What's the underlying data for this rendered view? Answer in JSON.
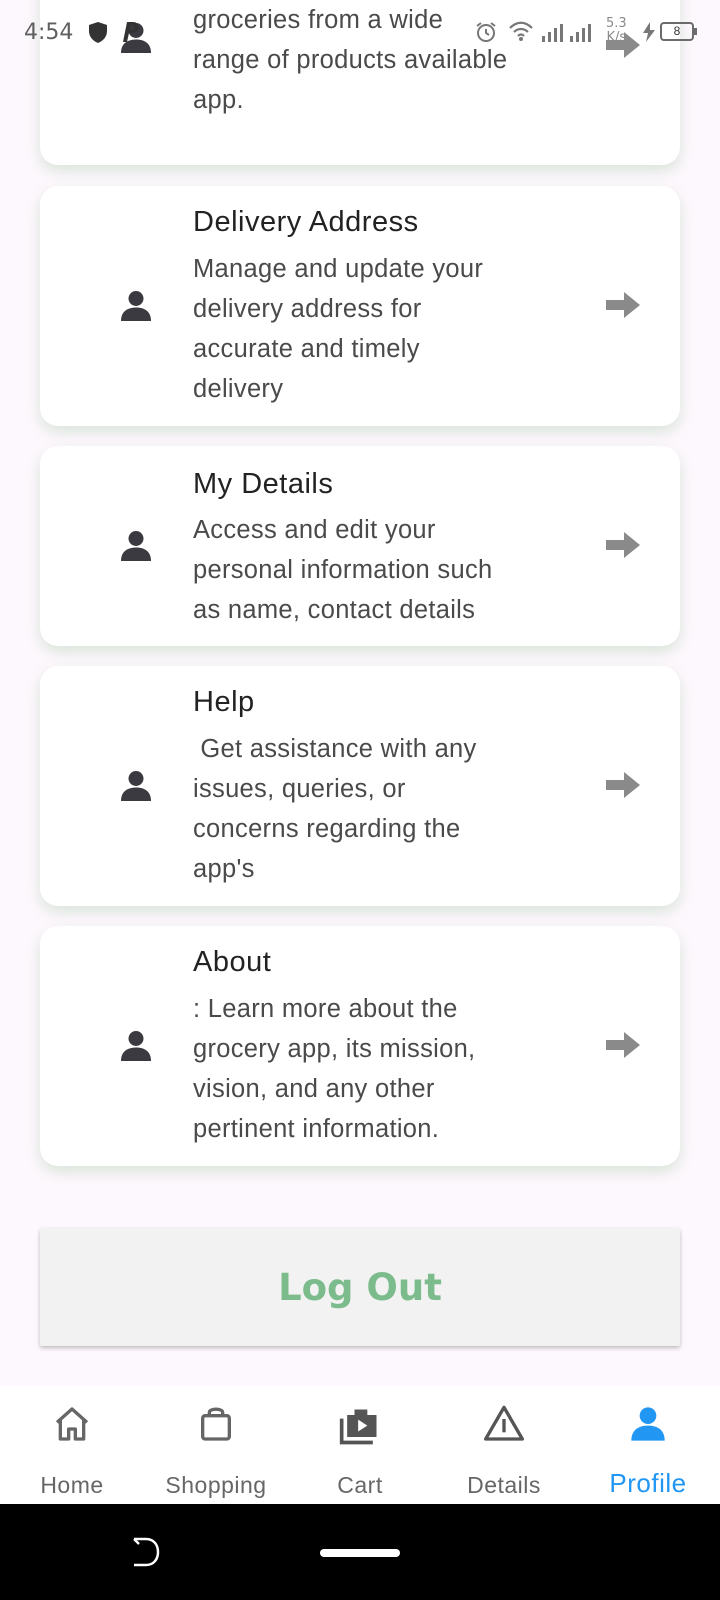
{
  "status_bar": {
    "time": "4:54",
    "net_speed_value": "5.3",
    "net_speed_unit": "K/s",
    "battery_level": "8"
  },
  "menu_items": [
    {
      "title": "",
      "description": "select, and purchase\ngroceries from a wide\nrange of products available\napp.",
      "icon": "person-icon",
      "action_icon": "arrow-right-icon"
    },
    {
      "title": "Delivery Address",
      "description": "Manage and update your\ndelivery address for\naccurate and timely\ndelivery",
      "icon": "person-icon",
      "action_icon": "arrow-right-icon"
    },
    {
      "title": "My Details",
      "description": "Access and edit your\npersonal information such\nas name, contact details",
      "icon": "person-icon",
      "action_icon": "arrow-right-icon"
    },
    {
      "title": "Help",
      "description": " Get assistance with any\nissues, queries, or\nconcerns regarding the\napp's",
      "icon": "person-icon",
      "action_icon": "arrow-right-icon"
    },
    {
      "title": "About",
      "description": ": Learn more about the\ngrocery app, its mission,\nvision, and any other\npertinent information.",
      "icon": "person-icon",
      "action_icon": "arrow-right-icon"
    }
  ],
  "logout": {
    "label": "Log Out"
  },
  "bottom_nav": {
    "items": [
      {
        "label": "Home",
        "icon": "home-icon"
      },
      {
        "label": "Shopping",
        "icon": "shopping-bag-icon"
      },
      {
        "label": "Cart",
        "icon": "cart-icon"
      },
      {
        "label": "Details",
        "icon": "warning-triangle-icon"
      },
      {
        "label": "Profile",
        "icon": "person-icon"
      }
    ],
    "active": "Profile"
  },
  "colors": {
    "accent": "#2196f3",
    "logout_text": "#7cbc8c",
    "card_shadow": "#82af82"
  }
}
